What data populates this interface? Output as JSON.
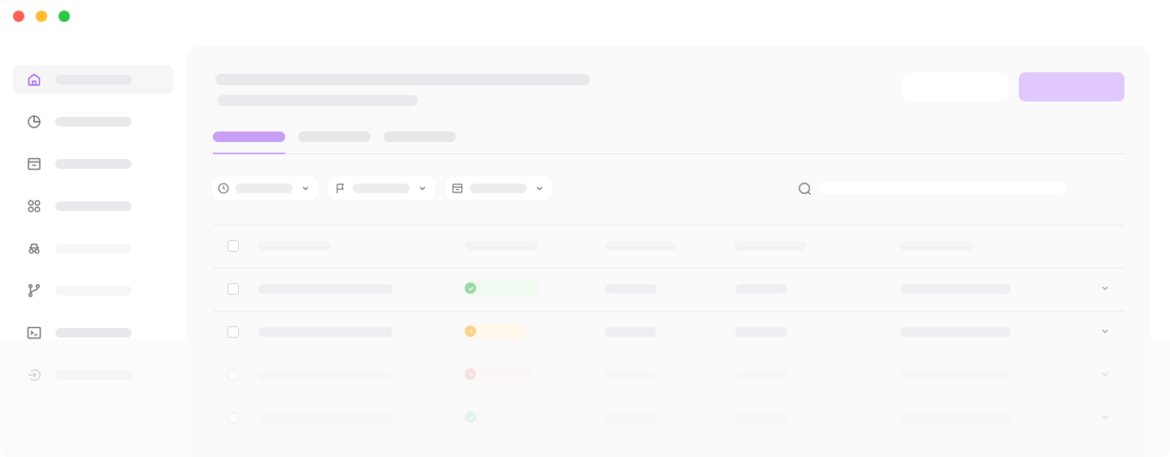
{
  "window": {
    "controls": [
      "close",
      "minimize",
      "zoom"
    ]
  },
  "sidebar": {
    "items": [
      {
        "icon": "home-icon",
        "label": "",
        "active": true
      },
      {
        "icon": "pie-chart-icon",
        "label": ""
      },
      {
        "icon": "inbox-icon",
        "label": ""
      },
      {
        "icon": "apps-icon",
        "label": ""
      },
      {
        "icon": "incognito-icon",
        "label": ""
      },
      {
        "icon": "git-branch-icon",
        "label": ""
      },
      {
        "icon": "terminal-icon",
        "label": ""
      },
      {
        "icon": "sign-in-icon",
        "label": ""
      }
    ]
  },
  "header": {
    "title": "",
    "subtitle": "",
    "secondary_button": "",
    "primary_button": ""
  },
  "tabs": [
    {
      "label": "",
      "active": true
    },
    {
      "label": ""
    },
    {
      "label": ""
    }
  ],
  "filters": [
    {
      "icon": "clock-icon",
      "label": ""
    },
    {
      "icon": "flag-icon",
      "label": ""
    },
    {
      "icon": "archive-icon",
      "label": ""
    }
  ],
  "search": {
    "placeholder": "",
    "value": ""
  },
  "table": {
    "headers": [
      "",
      "",
      "",
      "",
      ""
    ],
    "rows": [
      {
        "name": "",
        "status": "success",
        "col3": "",
        "col4": "",
        "col5": ""
      },
      {
        "name": "",
        "status": "pending",
        "col3": "",
        "col4": "",
        "col5": ""
      },
      {
        "name": "",
        "status": "blocked",
        "col3": "",
        "col4": "",
        "col5": ""
      },
      {
        "name": "",
        "status": "success",
        "col3": "",
        "col4": "",
        "col5": ""
      }
    ]
  },
  "colors": {
    "accent": "#c79ff5",
    "primary_button": "#e0c8fd",
    "success": "#2fb153",
    "pending": "#f2a51a",
    "blocked": "#e0504a"
  }
}
